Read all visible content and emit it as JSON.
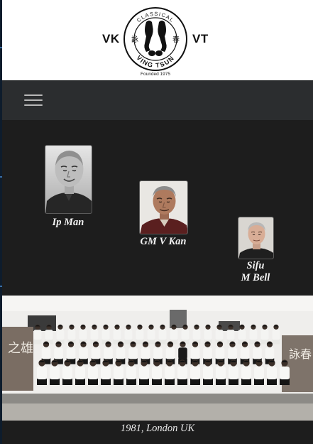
{
  "header": {
    "logo_left": "VK",
    "logo_right": "VT",
    "seal_top_text": "CLASSICAL",
    "seal_bottom_text": "VING TSUN",
    "seal_char_left": "詠",
    "seal_char_right": "春",
    "founded": "Founded 1975"
  },
  "nav": {
    "menu_icon": "hamburger-menu-icon"
  },
  "masters": [
    {
      "caption": "Ip Man"
    },
    {
      "caption": "GM V Kan"
    },
    {
      "caption_line1": "Sifu",
      "caption_line2": "M Bell"
    }
  ],
  "group_photo": {
    "caption": "1981, London UK",
    "banner_left": "之雄",
    "banner_right": "詠春"
  },
  "colors": {
    "logo_bar": "#ffffff",
    "navbar": "#2b2d2f",
    "page_background": "#1d1d1d",
    "caption_text": "#f2f2f2"
  }
}
